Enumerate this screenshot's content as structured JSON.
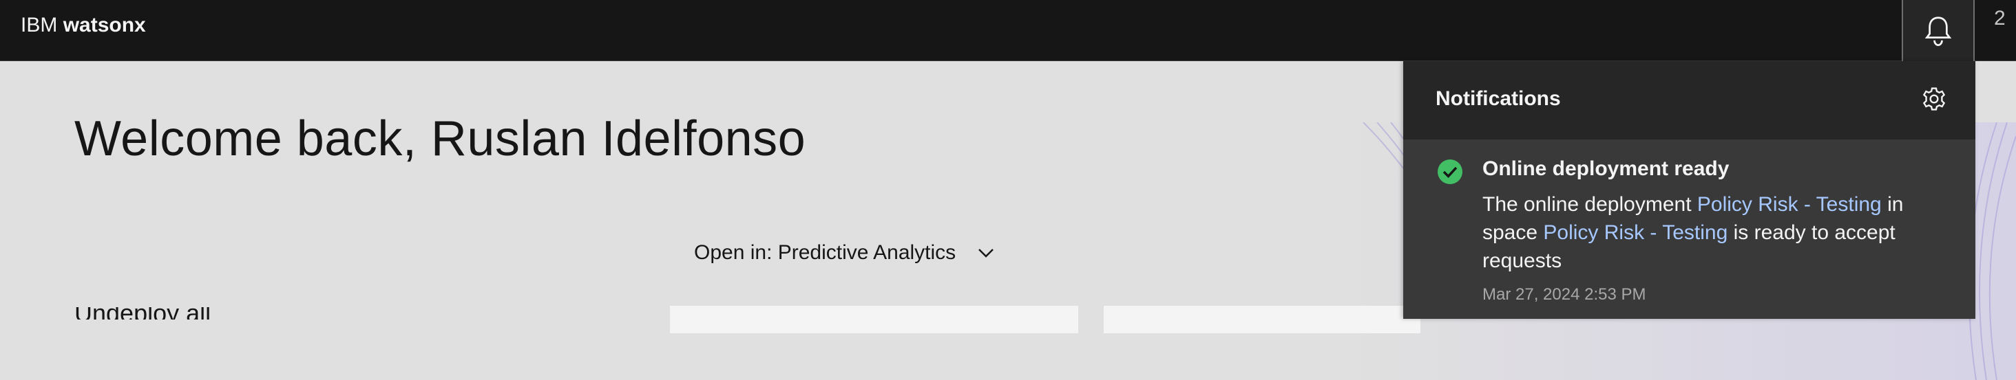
{
  "header": {
    "brand_prefix": "IBM",
    "brand_product": "watsonx",
    "right_fragment": "2",
    "notification_icon": "bell-icon"
  },
  "main": {
    "welcome": "Welcome back, Ruslan Idelfonso",
    "open_in": "Open in: Predictive Analytics",
    "bottom_label": "Undeploy  all"
  },
  "notifications": {
    "title": "Notifications",
    "settings_icon": "gear-icon",
    "items": [
      {
        "status_icon": "checkmark-filled-icon",
        "status_color": "#42be65",
        "title": "Online deployment ready",
        "text_1": "The online deployment ",
        "link_1": "Policy Risk - Testing",
        "text_2": " in space ",
        "link_2": "Policy Risk - Testing",
        "text_3": " is ready to accept requests",
        "timestamp": "Mar 27, 2024 2:53 PM"
      }
    ]
  },
  "colors": {
    "header_bg": "#161616",
    "page_bg": "#e0e0e0",
    "panel_bg": "#393939",
    "panel_header_bg": "#262626",
    "link": "#a6c8ff"
  }
}
